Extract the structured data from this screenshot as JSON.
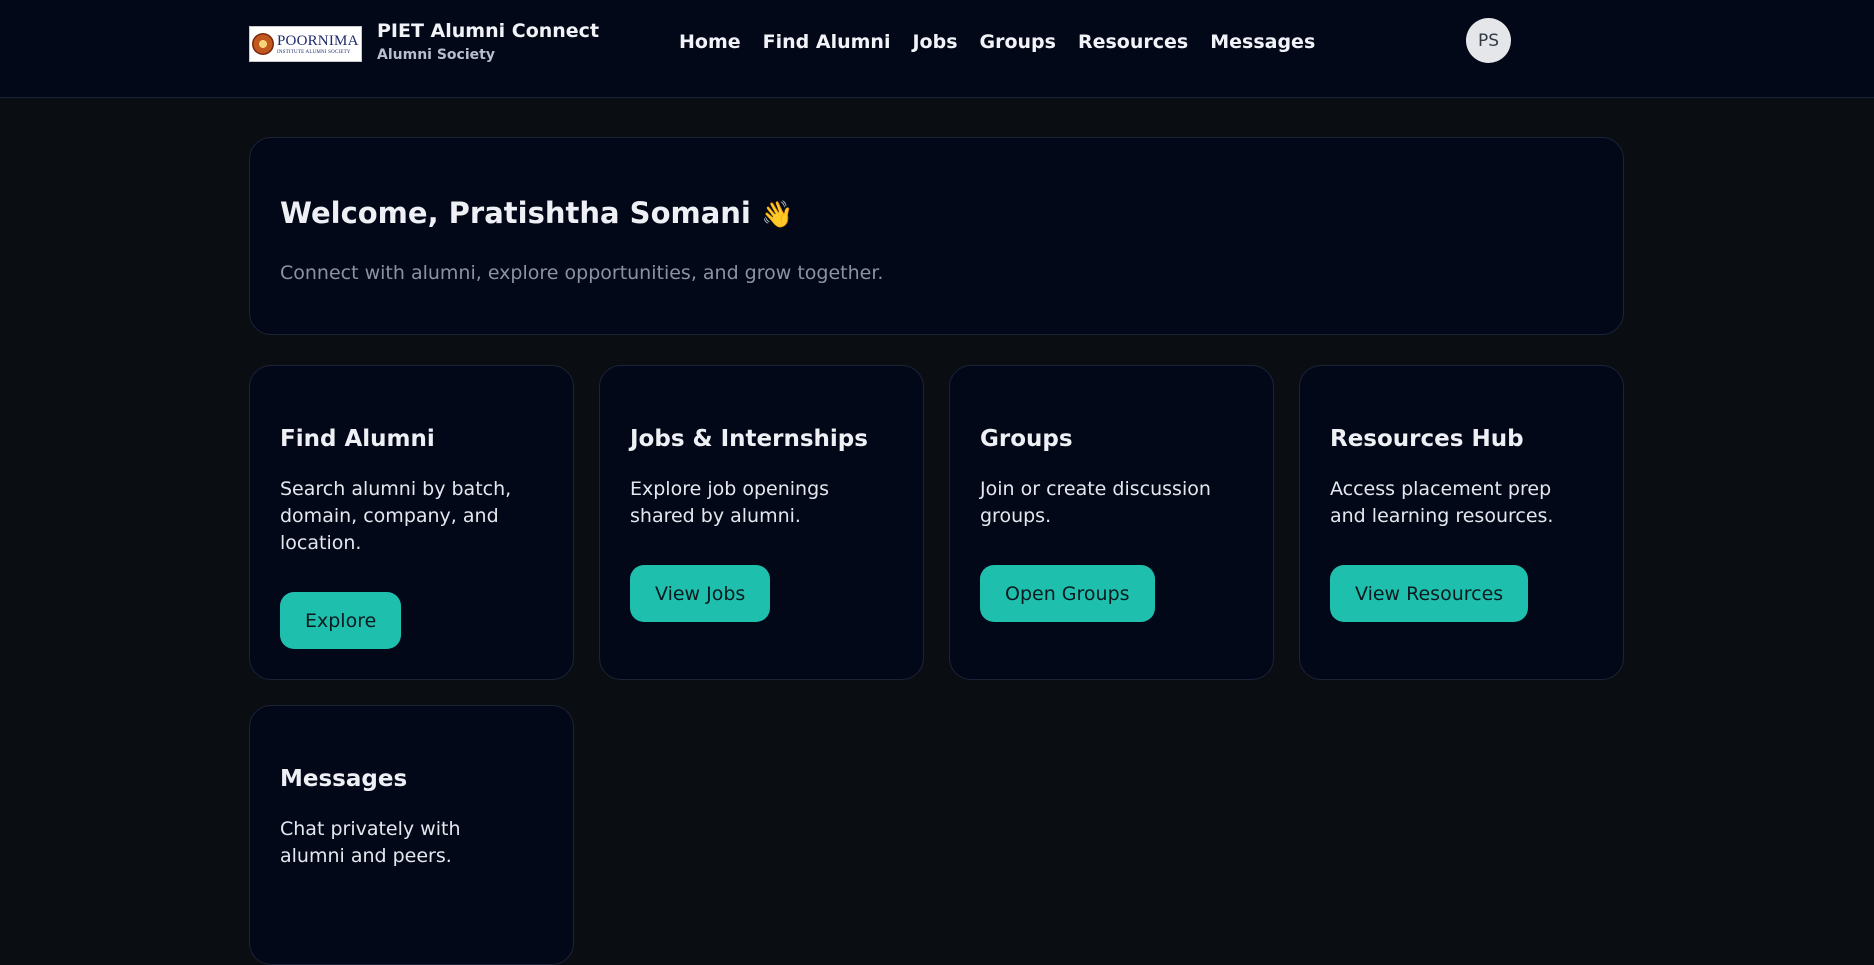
{
  "header": {
    "logo_word": "POORNIMA",
    "logo_sub": "INSTITUTE ALUMNI SOCIETY",
    "title": "PIET Alumni Connect",
    "subtitle": "Alumni Society",
    "nav": [
      "Home",
      "Find Alumni",
      "Jobs",
      "Groups",
      "Resources",
      "Messages"
    ],
    "avatar_initials": "PS"
  },
  "welcome": {
    "title": "Welcome, Pratishtha Somani",
    "emoji": "👋",
    "subtitle": "Connect with alumni, explore opportunities, and grow together."
  },
  "cards": [
    {
      "title": "Find Alumni",
      "desc": "Search alumni by batch, domain, company, and location.",
      "button": "Explore"
    },
    {
      "title": "Jobs & Internships",
      "desc": "Explore job openings shared by alumni.",
      "button": "View Jobs"
    },
    {
      "title": "Groups",
      "desc": "Join or create discussion groups.",
      "button": "Open Groups"
    },
    {
      "title": "Resources Hub",
      "desc": "Access placement prep and learning resources.",
      "button": "View Resources"
    },
    {
      "title": "Messages",
      "desc": "Chat privately with alumni and peers."
    }
  ]
}
